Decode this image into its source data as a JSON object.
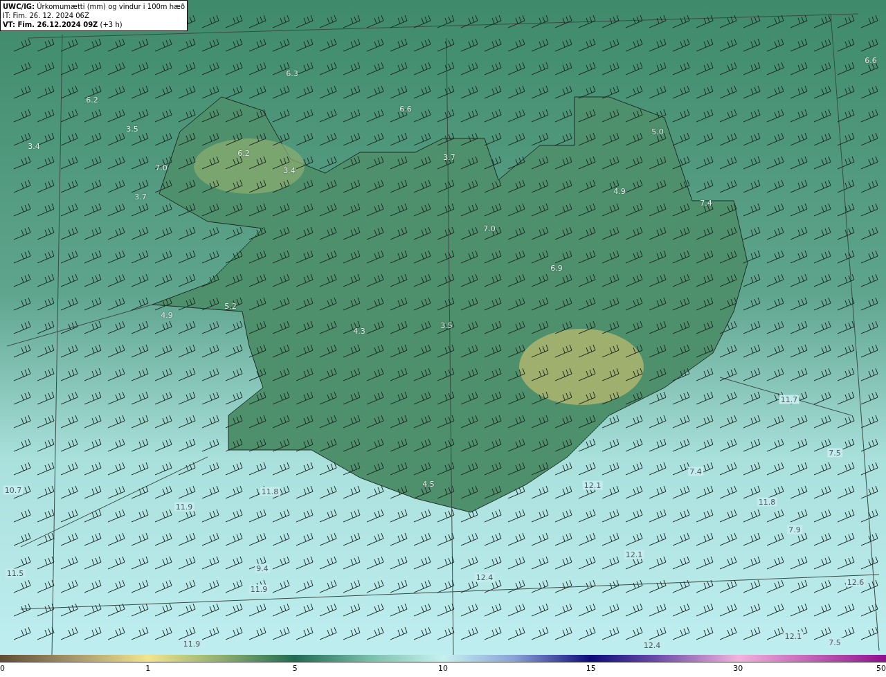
{
  "header": {
    "model": "UWC/IG:",
    "title": "Úrkomumætti (mm) og vindur i 100m hæð",
    "issue_time": "IT: Fim. 26. 12. 2024 06Z",
    "valid_time": "VT: Fim. 26.12.2024 09Z",
    "lead": "(+3 h)"
  },
  "map": {
    "value_labels": [
      "6.3",
      "6.6",
      "6.2",
      "6.6",
      "3.5",
      "5.0",
      "3.4",
      "6.2",
      "3.7",
      "7.0",
      "3.4",
      "4.9",
      "3.7",
      "7.0",
      "6.9",
      "5.2",
      "4.9",
      "3.5",
      "4.3",
      "4.5",
      "7.4",
      "10.7",
      "11.8",
      "11.9",
      "11.5",
      "9.4",
      "11.9",
      "11.9",
      "11.7",
      "7.5",
      "7.4",
      "12.1",
      "11.8",
      "7.9",
      "12.1",
      "12.4",
      "12.6",
      "12.1",
      "12.4",
      "7.5"
    ]
  },
  "colorbar": {
    "ticks": [
      "0",
      "1",
      "5",
      "10",
      "15",
      "30",
      "50"
    ]
  }
}
